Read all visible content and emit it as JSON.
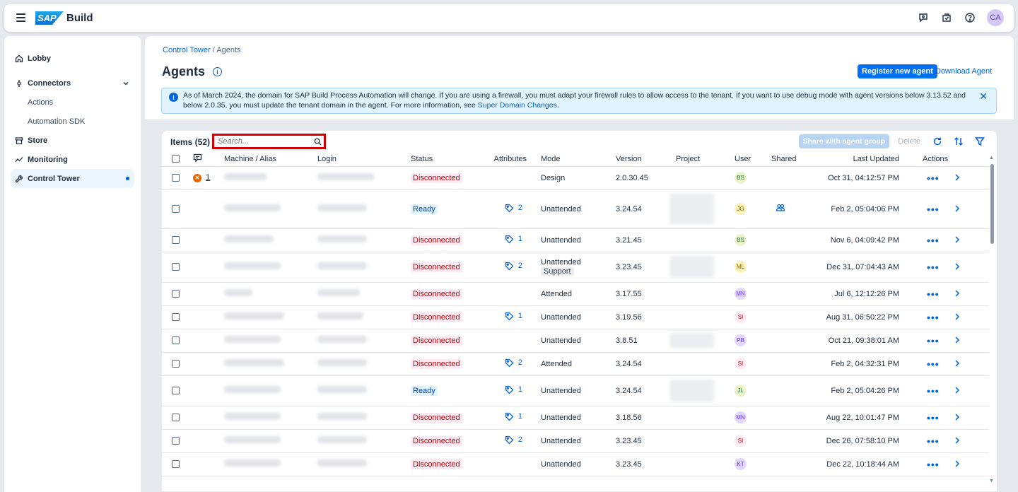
{
  "shell": {
    "brand": "Build",
    "logo_text": "SAP",
    "avatar": "CA",
    "icons": [
      "assistant-icon",
      "notifications-icon",
      "help-icon"
    ]
  },
  "nav": {
    "lobby": "Lobby",
    "connectors": "Connectors",
    "actions": "Actions",
    "automation_sdk": "Automation SDK",
    "store": "Store",
    "monitoring": "Monitoring",
    "control_tower": "Control Tower"
  },
  "breadcrumb": {
    "parent": "Control Tower",
    "sep": "/",
    "current": "Agents"
  },
  "page": {
    "title": "Agents",
    "register_label": "Register new agent",
    "download_label": "Download Agent"
  },
  "strip": {
    "text": "As of March 2024, the domain for SAP Build Process Automation will change. If you are using a firewall, you must adapt your firewall rules to allow access to the tenant. If you want to use debug mode with agent versions below 3.13.52 and below 2.0.35, you must update the tenant domain in the agent. For more information, see",
    "link": "Super Domain Changes",
    "end": "."
  },
  "toolbar": {
    "items_label": "Items (52)",
    "search_placeholder": "Search...",
    "share_label": "Share with agent group",
    "delete_label": "Delete"
  },
  "columns": {
    "machine": "Machine / Alias",
    "login": "Login",
    "status": "Status",
    "attributes": "Attributes",
    "mode": "Mode",
    "version": "Version",
    "project": "Project",
    "user": "User",
    "shared": "Shared",
    "last_updated": "Last Updated",
    "actions": "Actions"
  },
  "rows": [
    {
      "error_count": "1",
      "status": "Disconnected",
      "attr": "",
      "mode": "Design",
      "support": "",
      "version": "2.0.30.45",
      "project": false,
      "user": "BS",
      "shared": false,
      "updated": "Oct 31, 04:12:57 PM",
      "h": 33
    },
    {
      "error_count": "",
      "status": "Ready",
      "attr": "2",
      "mode": "Unattended",
      "support": "",
      "version": "3.24.54",
      "project": true,
      "user": "JG",
      "shared": true,
      "updated": "Feb 2, 05:04:06 PM",
      "h": 55
    },
    {
      "error_count": "",
      "status": "Disconnected",
      "attr": "1",
      "mode": "Unattended",
      "support": "",
      "version": "3.21.45",
      "project": false,
      "user": "BS",
      "shared": false,
      "updated": "Nov 6, 04:09:42 PM",
      "h": 33
    },
    {
      "error_count": "",
      "status": "Disconnected",
      "attr": "2",
      "mode": "Unattended",
      "support": "Support",
      "version": "3.23.45",
      "project": true,
      "user": "ML",
      "shared": false,
      "updated": "Dec 31, 07:04:43 AM",
      "h": 43
    },
    {
      "error_count": "",
      "status": "Disconnected",
      "attr": "",
      "mode": "Attended",
      "support": "",
      "version": "3.17.55",
      "project": false,
      "user": "MN",
      "shared": false,
      "updated": "Jul 6, 12:12:26 PM",
      "h": 33
    },
    {
      "error_count": "",
      "status": "Disconnected",
      "attr": "1",
      "mode": "Unattended",
      "support": "",
      "version": "3.19.56",
      "project": false,
      "user": "SI",
      "shared": false,
      "updated": "Aug 31, 06:50:22 PM",
      "h": 33
    },
    {
      "error_count": "",
      "status": "Disconnected",
      "attr": "",
      "mode": "Unattended",
      "support": "",
      "version": "3.8.51",
      "project": true,
      "user": "PB",
      "shared": false,
      "updated": "Oct 21, 09:38:01 AM",
      "h": 33
    },
    {
      "error_count": "",
      "status": "Disconnected",
      "attr": "2",
      "mode": "Attended",
      "support": "",
      "version": "3.24.54",
      "project": false,
      "user": "SI",
      "shared": false,
      "updated": "Feb 2, 04:32:31 PM",
      "h": 33
    },
    {
      "error_count": "",
      "status": "Ready",
      "attr": "1",
      "mode": "Unattended",
      "support": "",
      "version": "3.24.54",
      "project": true,
      "user": "JL",
      "shared": false,
      "updated": "Feb 2, 05:04:26 PM",
      "h": 43
    },
    {
      "error_count": "",
      "status": "Disconnected",
      "attr": "1",
      "mode": "Unattended",
      "support": "",
      "version": "3.18.56",
      "project": false,
      "user": "MN",
      "shared": false,
      "updated": "Aug 22, 10:01:47 PM",
      "h": 33
    },
    {
      "error_count": "",
      "status": "Disconnected",
      "attr": "2",
      "mode": "Unattended",
      "support": "",
      "version": "3.23.45",
      "project": false,
      "user": "SI",
      "shared": false,
      "updated": "Dec 26, 07:58:10 PM",
      "h": 33
    },
    {
      "error_count": "",
      "status": "Disconnected",
      "attr": "",
      "mode": "Unattended",
      "support": "",
      "version": "3.23.45",
      "project": false,
      "user": "KT",
      "shared": false,
      "updated": "Dec 22, 10:18:44 AM",
      "h": 33
    }
  ],
  "user_colors": {
    "BS": [
      "#ebf5cb",
      "#256f3a"
    ],
    "JG": [
      "#fff3b8",
      "#8d6200"
    ],
    "ML": [
      "#fff3b8",
      "#8d6200"
    ],
    "MN": [
      "#e2d8ff",
      "#5d36ff"
    ],
    "SI": [
      "#ffeaf4",
      "#aa0808"
    ],
    "PB": [
      "#e2d8ff",
      "#5d36ff"
    ],
    "JL": [
      "#ebf5cb",
      "#256f3a"
    ],
    "KT": [
      "#e2d8ff",
      "#5d36ff"
    ]
  },
  "row_action_label": "•••",
  "row_nav_label": "›"
}
